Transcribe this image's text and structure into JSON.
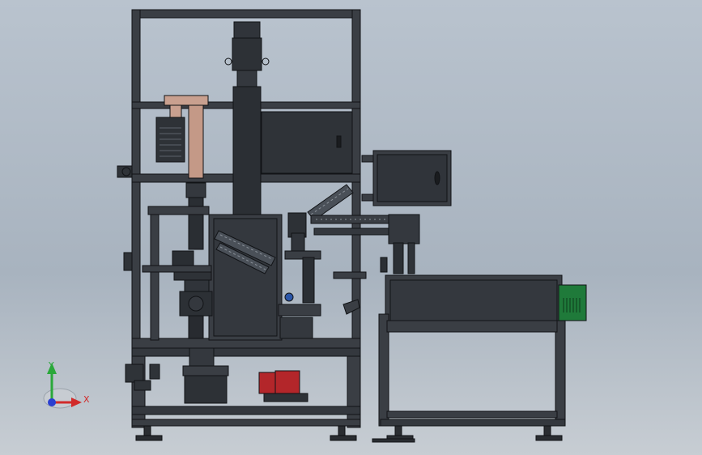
{
  "viewport": {
    "background_top": "#b9c3ce",
    "background_bottom": "#c7cdd3"
  },
  "model": {
    "frame_color": "#3a3e44",
    "panel_color": "#2f3338",
    "edge_color": "#111316",
    "accent_pink": "#c9a08f",
    "motor_red": "#b3262a",
    "control_box_green": "#1f7a3a"
  },
  "triad": {
    "x_label": "X",
    "y_label": "Y",
    "x_color": "#d12a2a",
    "y_color": "#2aa83a",
    "z_color": "#2a3fd1"
  }
}
